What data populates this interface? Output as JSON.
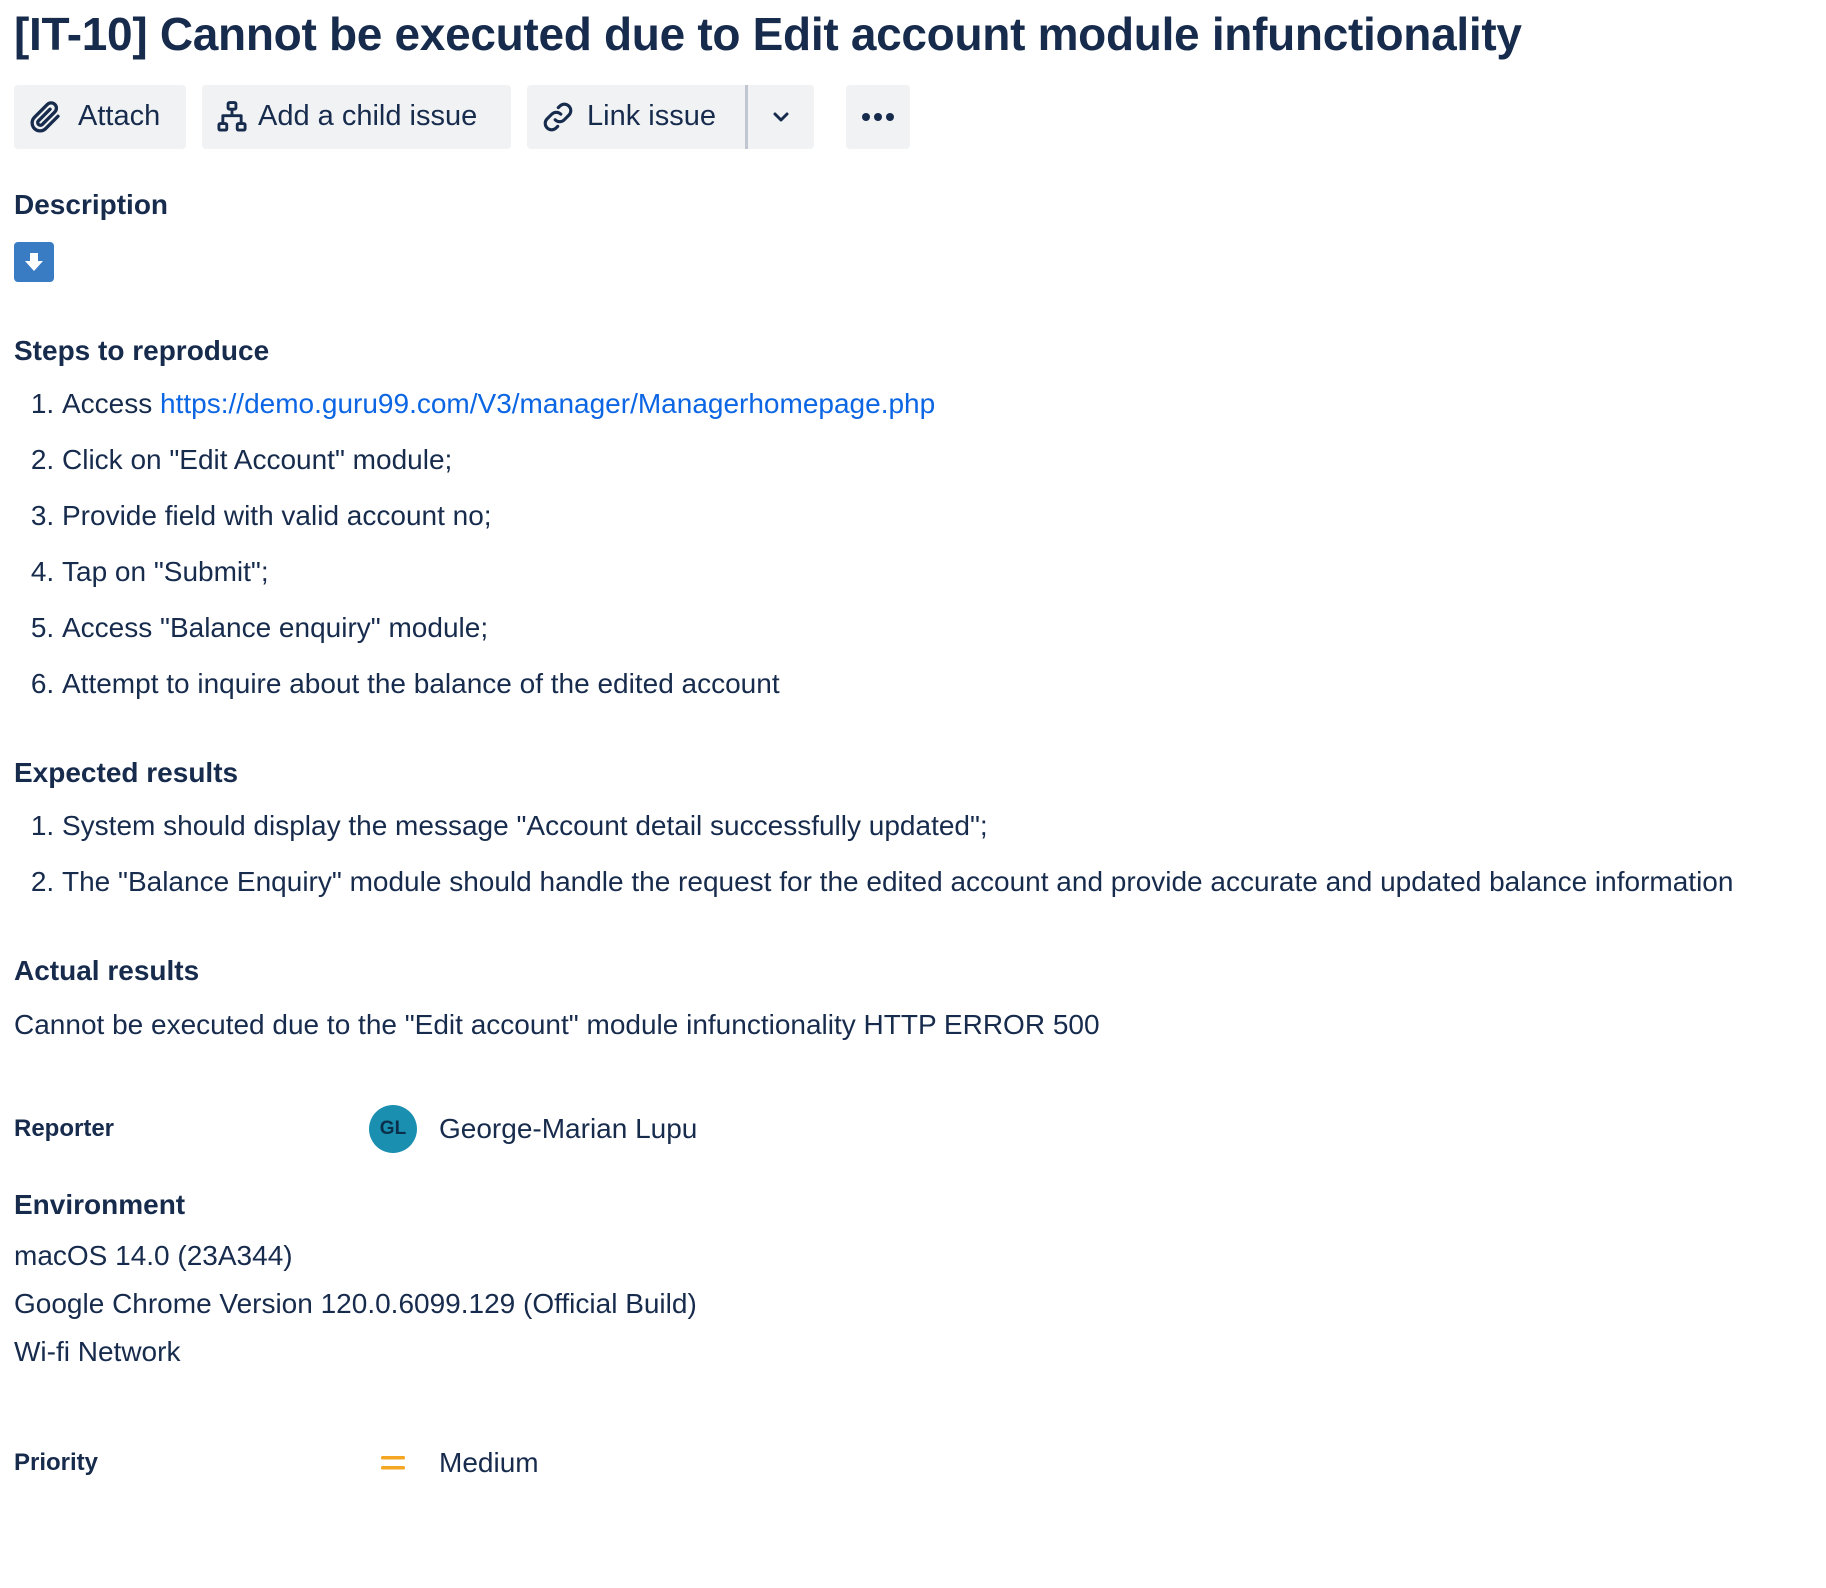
{
  "issue": {
    "title": "[IT-10] Cannot be executed due to Edit account module infunctionality"
  },
  "toolbar": {
    "attach_label": "Attach",
    "add_child_label": "Add a child issue",
    "link_issue_label": "Link issue"
  },
  "description": {
    "heading": "Description",
    "steps_heading": "Steps to reproduce",
    "steps": [
      {
        "text": "Access ",
        "link": "https://demo.guru99.com/V3/manager/Managerhomepage.php"
      },
      {
        "text": "Click on \"Edit Account\" module;"
      },
      {
        "text": "Provide field with valid account no;"
      },
      {
        "text": "Tap on \"Submit\";"
      },
      {
        "text": "Access \"Balance enquiry\" module;"
      },
      {
        "text": "Attempt to inquire about the balance of the edited account"
      }
    ],
    "expected_heading": "Expected results",
    "expected": [
      "System should display the message \"Account detail successfully updated\";",
      "The \"Balance Enquiry\" module should handle the request for the edited account and provide accurate and updated balance information"
    ],
    "actual_heading": "Actual results",
    "actual_text": "Cannot be executed due to the \"Edit account\" module infunctionality HTTP ERROR 500"
  },
  "reporter": {
    "label": "Reporter",
    "initials": "GL",
    "name": "George-Marian Lupu",
    "avatar_color": "#1a8fb0"
  },
  "environment": {
    "heading": "Environment",
    "lines": [
      "macOS 14.0 (23A344)",
      "Google Chrome Version 120.0.6099.129 (Official Build)",
      "Wi-fi Network"
    ]
  },
  "priority": {
    "label": "Priority",
    "value": "Medium",
    "icon_color": "#f5a623"
  },
  "colors": {
    "text": "#172b4d",
    "link": "#0c66e4",
    "button_bg": "#f1f2f4",
    "badge_blue": "#3a7cc4"
  }
}
